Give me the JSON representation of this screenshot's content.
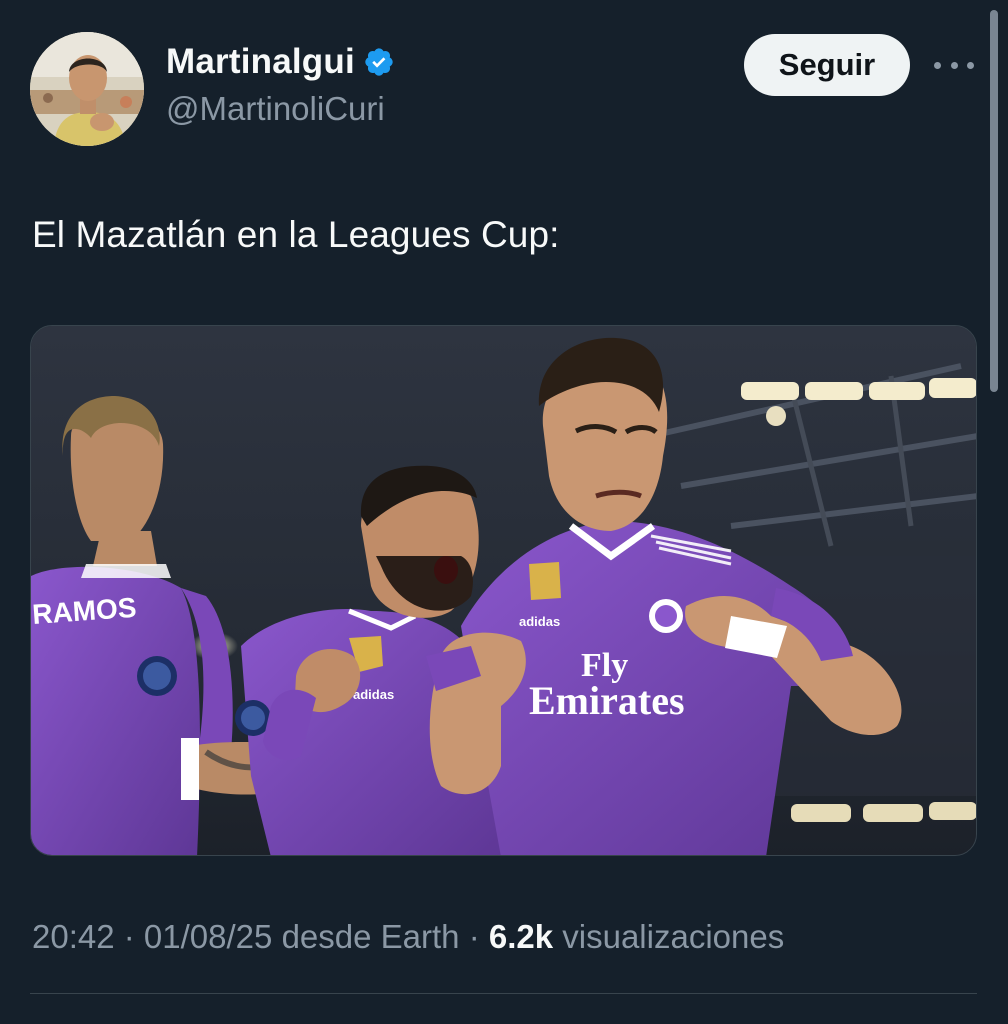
{
  "author": {
    "display_name": "Martinalgui",
    "handle": "@MartinoliCuri",
    "verified": true,
    "avatar": "profile-photo"
  },
  "follow_button": {
    "label": "Seguir"
  },
  "more_menu": {
    "icon": "more-horizontal-icon"
  },
  "tweet": {
    "text": "El Mazatlán en la Leagues Cup:"
  },
  "media": {
    "kind": "photo",
    "jersey_sponsor_line1": "Fly",
    "jersey_sponsor_line2": "Emirates",
    "jersey_back_name": "RAMOS",
    "jersey_brand": "adidas"
  },
  "meta": {
    "time": "20:42",
    "separator": " · ",
    "date": "01/08/25",
    "source": "desde Earth",
    "views_count": "6.2k",
    "views_label": "visualizaciones"
  },
  "colors": {
    "background": "#15202b",
    "text_primary": "#f7f9f9",
    "text_secondary": "#8b98a5",
    "verified_badge": "#1d9bf0",
    "follow_button_bg": "#eff3f4",
    "divider": "#38444d",
    "kit_purple": "#7a48b8"
  }
}
